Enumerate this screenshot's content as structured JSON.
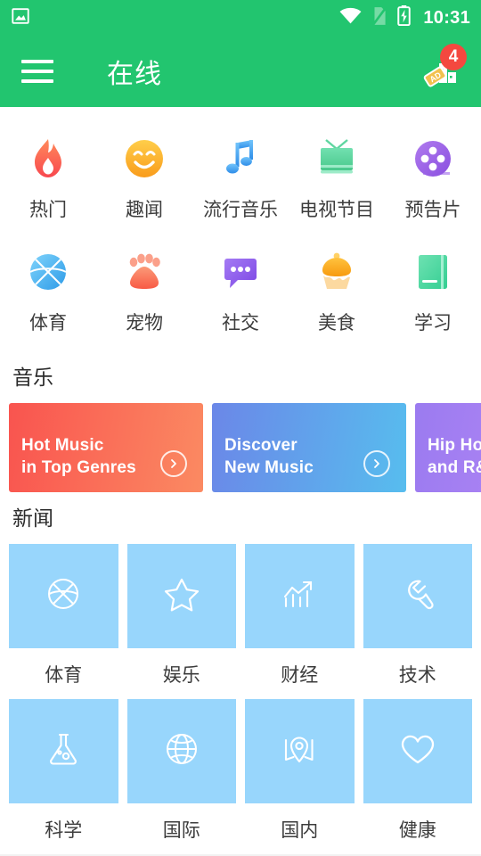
{
  "status_bar": {
    "time": "10:31",
    "icons": [
      "image-notification-icon",
      "wifi-icon",
      "no-sim-icon",
      "battery-charging-icon"
    ]
  },
  "app_bar": {
    "menu_icon": "hamburger-menu-icon",
    "title": "在线",
    "action_icon": "ad-tag-icon",
    "badge_count": "4",
    "background_color": "#22C56F",
    "badge_color": "#F4483F"
  },
  "categories": [
    {
      "label": "热门",
      "icon": "flame-icon",
      "color": "#FB6A4A"
    },
    {
      "label": "趣闻",
      "icon": "smiley-face-icon",
      "color": "#FBB03B"
    },
    {
      "label": "流行音乐",
      "icon": "music-note-icon",
      "color": "#4FA8F7"
    },
    {
      "label": "电视节目",
      "icon": "television-icon",
      "color": "#5FD6A0"
    },
    {
      "label": "预告片",
      "icon": "film-reel-icon",
      "color": "#9B5FE0"
    },
    {
      "label": "体育",
      "icon": "basketball-icon",
      "color": "#4FB8F7"
    },
    {
      "label": "宠物",
      "icon": "paw-print-icon",
      "color": "#FA7A5A"
    },
    {
      "label": "社交",
      "icon": "chat-bubble-icon",
      "color": "#8B5CF6"
    },
    {
      "label": "美食",
      "icon": "cupcake-icon",
      "color": "#FBA518"
    },
    {
      "label": "学习",
      "icon": "book-icon",
      "color": "#4FD6A0"
    }
  ],
  "music": {
    "section_title": "音乐",
    "cards": [
      {
        "line1": "Hot Music",
        "line2": "in Top Genres",
        "arrow_icon": "chevron-right-circle-icon",
        "gradient_from": "#F9544F",
        "gradient_to": "#FB8A62"
      },
      {
        "line1": "Discover",
        "line2": "New Music",
        "arrow_icon": "chevron-right-circle-icon",
        "gradient_from": "#6B87E8",
        "gradient_to": "#57BDEE"
      },
      {
        "line1": "Hip Hop",
        "line2": "and R&B",
        "arrow_icon": "chevron-right-circle-icon",
        "gradient_from": "#9B7BF0",
        "gradient_to": "#BA8AF7"
      }
    ]
  },
  "news": {
    "section_title": "新闻",
    "tile_color": "#98D6FC",
    "items": [
      {
        "label": "体育",
        "icon": "basketball-outline-icon"
      },
      {
        "label": "娱乐",
        "icon": "star-outline-icon"
      },
      {
        "label": "财经",
        "icon": "chart-growth-icon"
      },
      {
        "label": "技术",
        "icon": "wrench-icon"
      },
      {
        "label": "科学",
        "icon": "flask-icon"
      },
      {
        "label": "国际",
        "icon": "globe-icon"
      },
      {
        "label": "国内",
        "icon": "map-pin-icon"
      },
      {
        "label": "健康",
        "icon": "heart-outline-icon"
      }
    ]
  }
}
